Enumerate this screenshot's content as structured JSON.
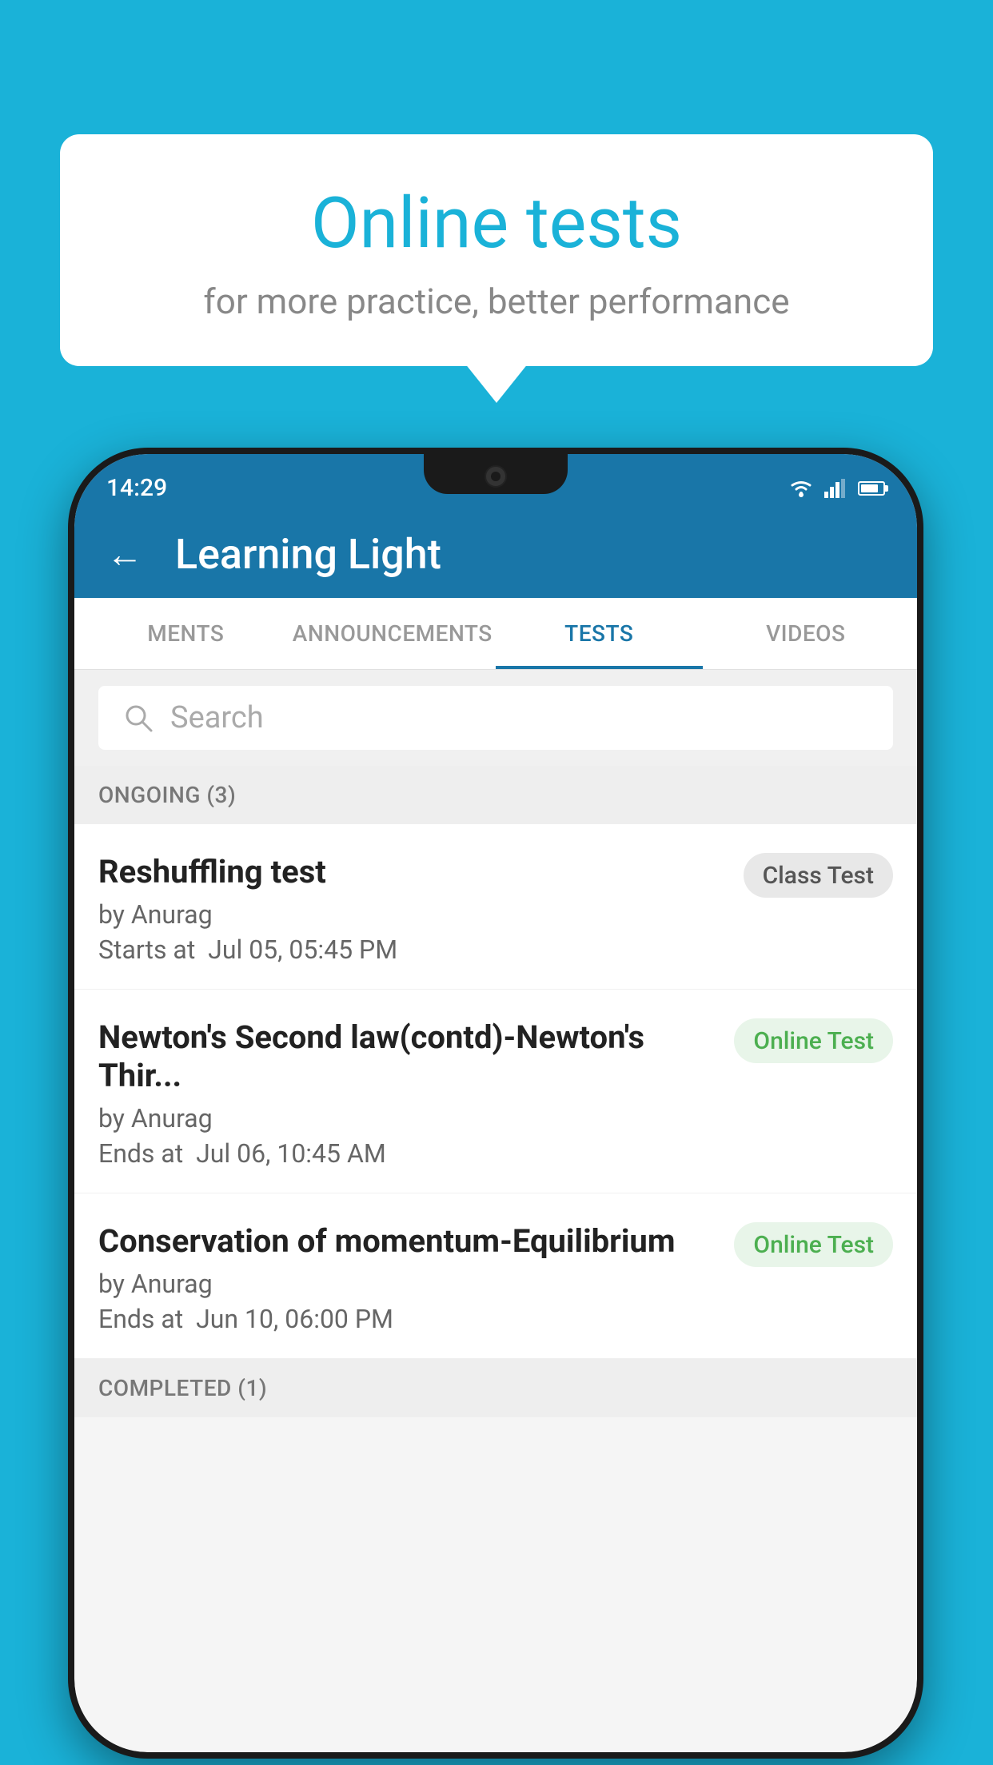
{
  "background_color": "#1ab2d8",
  "bubble": {
    "title": "Online tests",
    "subtitle": "for more practice, better performance"
  },
  "status_bar": {
    "time": "14:29",
    "wifi": "▼",
    "signal": "▲",
    "battery": "battery"
  },
  "app_bar": {
    "back_label": "←",
    "title": "Learning Light"
  },
  "tabs": [
    {
      "label": "MENTS",
      "active": false
    },
    {
      "label": "ANNOUNCEMENTS",
      "active": false
    },
    {
      "label": "TESTS",
      "active": true
    },
    {
      "label": "VIDEOS",
      "active": false
    }
  ],
  "search": {
    "placeholder": "Search"
  },
  "ongoing_section": {
    "label": "ONGOING (3)"
  },
  "tests": [
    {
      "title": "Reshuffling test",
      "author": "by Anurag",
      "date_label": "Starts at",
      "date": "Jul 05, 05:45 PM",
      "badge": "Class Test",
      "badge_type": "class"
    },
    {
      "title": "Newton's Second law(contd)-Newton's Thir...",
      "author": "by Anurag",
      "date_label": "Ends at",
      "date": "Jul 06, 10:45 AM",
      "badge": "Online Test",
      "badge_type": "online"
    },
    {
      "title": "Conservation of momentum-Equilibrium",
      "author": "by Anurag",
      "date_label": "Ends at",
      "date": "Jun 10, 06:00 PM",
      "badge": "Online Test",
      "badge_type": "online"
    }
  ],
  "completed_section": {
    "label": "COMPLETED (1)"
  }
}
